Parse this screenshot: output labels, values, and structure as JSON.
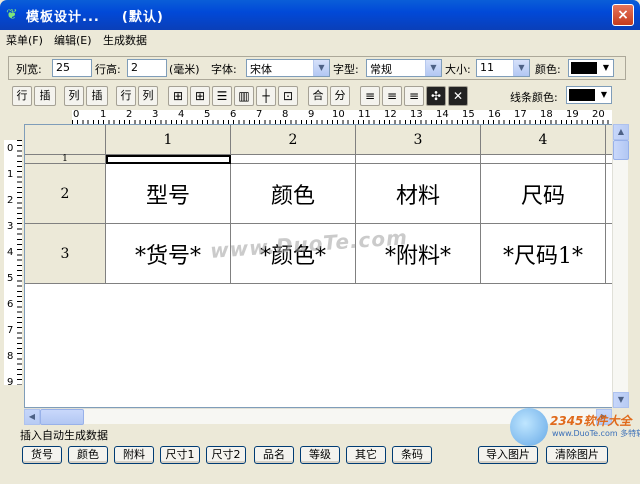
{
  "window": {
    "title": "模板设计...    (默认)",
    "close_glyph": "×",
    "app_icon_glyph": "❦"
  },
  "menu": [
    {
      "label": "菜单(F)"
    },
    {
      "label": "编辑(E)"
    },
    {
      "label": "生成数据"
    }
  ],
  "format_bar": {
    "col_width_label": "列宽:",
    "col_width_value": "25",
    "row_height_label": "行高:",
    "row_height_value": "2",
    "unit_label": "(毫米)",
    "font_label": "字体:",
    "font_value": "宋体",
    "style_label": "字型:",
    "style_value": "常规",
    "size_label": "大小:",
    "size_value": "11",
    "color_label": "颜色:",
    "color_value": "#000000",
    "line_color_label": "线条颜色:"
  },
  "edit_bar": {
    "row_label": "行",
    "insert_label": "插",
    "col_label": "列",
    "insert2_label": "插",
    "row2_label": "行",
    "col2_label": "列",
    "merge_label": "合",
    "split_label": "分"
  },
  "ruler": {
    "top": [
      "0",
      "1",
      "2",
      "3",
      "4",
      "5",
      "6",
      "7",
      "8",
      "9",
      "10",
      "11",
      "12",
      "13",
      "14",
      "15",
      "16",
      "17",
      "18",
      "19",
      "20"
    ],
    "left": [
      "0",
      "1",
      "2",
      "3",
      "4",
      "5",
      "6",
      "7",
      "8",
      "9"
    ]
  },
  "grid": {
    "col_headers": [
      "1",
      "2",
      "3",
      "4"
    ],
    "row_headers": [
      "1",
      "2",
      "3"
    ],
    "row2": [
      "型号",
      "颜色",
      "材料",
      "尺码"
    ],
    "row3": [
      "*货号*",
      "*颜色*",
      "*附料*",
      "*尺码1*"
    ]
  },
  "bottom": {
    "insert_label": "插入自动生成数据",
    "fields": [
      "货号",
      "颜色",
      "附料",
      "尺寸1",
      "尺寸2",
      "品名",
      "等级",
      "其它",
      "条码"
    ],
    "import_image": "导入图片",
    "clear_image": "清除图片"
  },
  "watermark": {
    "text": "www.DuoTe.com",
    "brand": "2345软件大全",
    "site": "www.DuoTe.com 多特软件站"
  }
}
